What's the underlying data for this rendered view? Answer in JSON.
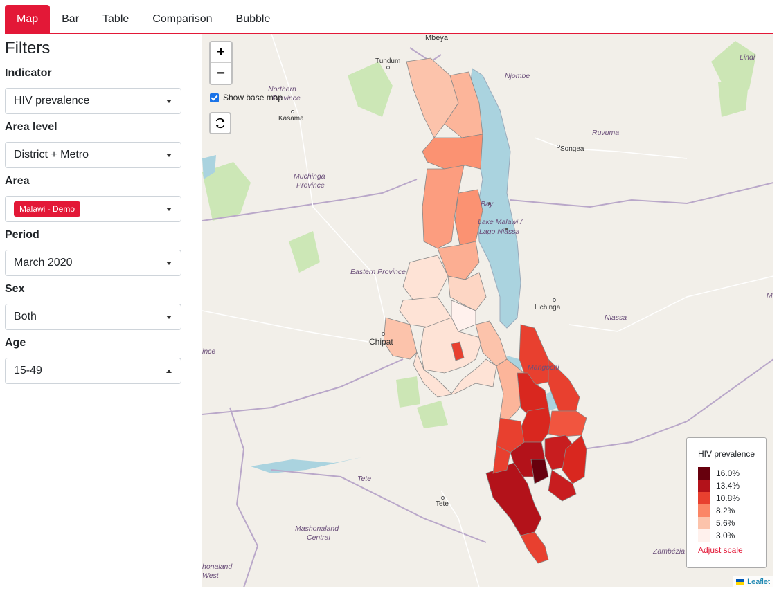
{
  "tabs": [
    {
      "label": "Map"
    },
    {
      "label": "Bar"
    },
    {
      "label": "Table"
    },
    {
      "label": "Comparison"
    },
    {
      "label": "Bubble"
    }
  ],
  "filters": {
    "title": "Filters",
    "indicator": {
      "label": "Indicator",
      "value": "HIV prevalence"
    },
    "area_level": {
      "label": "Area level",
      "value": "District + Metro"
    },
    "area": {
      "label": "Area",
      "value": "Malawi - Demo"
    },
    "period": {
      "label": "Period",
      "value": "March 2020"
    },
    "sex": {
      "label": "Sex",
      "value": "Both"
    },
    "age": {
      "label": "Age",
      "value": "15-49"
    }
  },
  "map": {
    "zoom_in": "+",
    "zoom_out": "−",
    "show_base_map": "Show base map",
    "places": {
      "mbeya": "Mbeya",
      "tundum": "Tundum",
      "njombe": "Njombe",
      "lindi": "Lindi",
      "northern_province_1": "Northern",
      "northern_province_2": "Province",
      "kasama": "Kasama",
      "ruvuma": "Ruvuma",
      "songea": "Songea",
      "muchinga_1": "Muchinga",
      "muchinga_2": "Province",
      "lake_1": "Lake Malawi /",
      "lake_2": "Lago Niassa",
      "eastern_province": "Eastern Province",
      "lichinga": "Lichinga",
      "niassa": "Niassa",
      "chipat": "Chipat",
      "ince": "ince",
      "mangochi": "Mangochi",
      "tete_region": "Tete",
      "tete_city": "Tete",
      "mashonaland_1": "Mashonaland",
      "mashonaland_2": "Central",
      "zambezia": "Zambézia",
      "west_1": "honaland",
      "west_2": "West",
      "mo": "Mo",
      "bay": "Bay"
    },
    "attribution": "Leaflet"
  },
  "legend": {
    "title": "HIV prevalence",
    "items": [
      {
        "label": "16.0%",
        "color": "#67000d"
      },
      {
        "label": "13.4%",
        "color": "#b3121a"
      },
      {
        "label": "10.8%",
        "color": "#e8402f"
      },
      {
        "label": "8.2%",
        "color": "#fb8666"
      },
      {
        "label": "5.6%",
        "color": "#fcc3ab"
      },
      {
        "label": "3.0%",
        "color": "#fff1ed"
      }
    ],
    "adjust_link": "Adjust scale"
  },
  "colors": {
    "accent": "#e31837",
    "lake": "#aad3df",
    "land": "#f2efe9",
    "park": "#c8e6b0"
  }
}
